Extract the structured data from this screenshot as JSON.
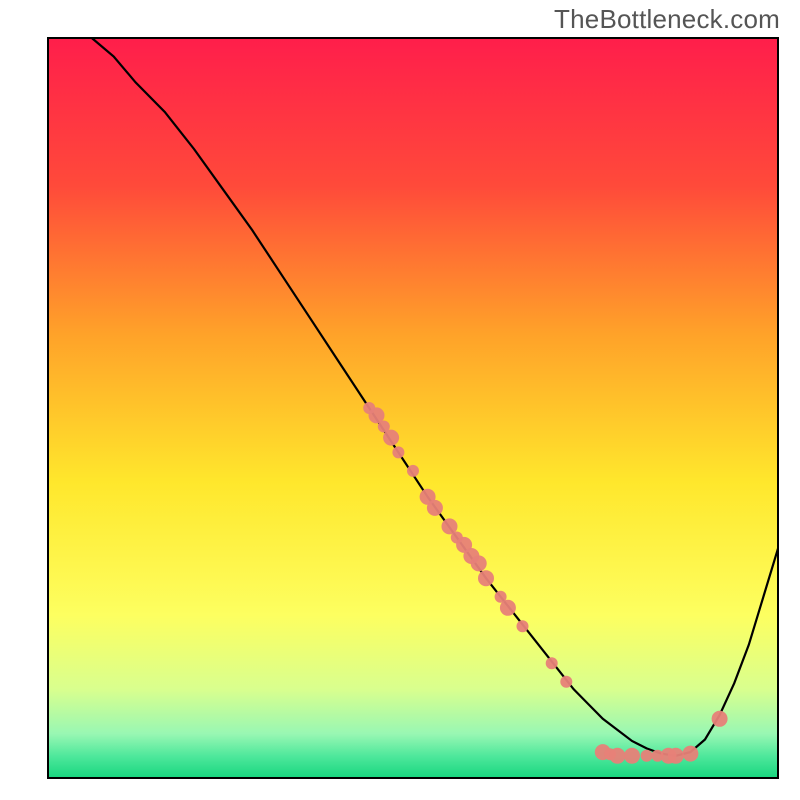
{
  "watermark": "TheBottleneck.com",
  "chart_data": {
    "type": "line",
    "title": "",
    "xlabel": "",
    "ylabel": "",
    "xlim": [
      0,
      100
    ],
    "ylim": [
      0,
      100
    ],
    "grid": false,
    "legend": false,
    "background_gradient": {
      "direction": "top-to-bottom",
      "stops": [
        {
          "pos": 0.0,
          "color": "#ff1e4b"
        },
        {
          "pos": 0.2,
          "color": "#ff4a3a"
        },
        {
          "pos": 0.4,
          "color": "#ffa229"
        },
        {
          "pos": 0.6,
          "color": "#ffe72c"
        },
        {
          "pos": 0.78,
          "color": "#fdff60"
        },
        {
          "pos": 0.88,
          "color": "#d9ff8e"
        },
        {
          "pos": 0.94,
          "color": "#99f7b3"
        },
        {
          "pos": 0.97,
          "color": "#4fe89c"
        },
        {
          "pos": 1.0,
          "color": "#18d67f"
        }
      ]
    },
    "series": [
      {
        "name": "bottleneck-curve",
        "color": "#000000",
        "x": [
          6,
          9,
          12,
          16,
          20,
          24,
          28,
          32,
          36,
          40,
          44,
          48,
          52,
          56,
          60,
          64,
          68,
          72,
          74,
          76,
          78,
          80,
          82,
          84,
          86,
          88,
          90,
          92,
          94,
          96,
          100
        ],
        "y": [
          100,
          97.5,
          94,
          90,
          85,
          79.5,
          74,
          68,
          62,
          56,
          50,
          44,
          38,
          32.5,
          27,
          22,
          17,
          12,
          10,
          8,
          6.5,
          5,
          4,
          3.3,
          3,
          3.5,
          5.2,
          8.5,
          12.8,
          18,
          31
        ]
      }
    ],
    "scatter_points": {
      "name": "data-points",
      "color": "#e78178",
      "radius_small": 6,
      "radius_large": 8,
      "points": [
        {
          "x": 44,
          "y": 50,
          "r": 6
        },
        {
          "x": 45,
          "y": 49,
          "r": 8
        },
        {
          "x": 46,
          "y": 47.5,
          "r": 6
        },
        {
          "x": 47,
          "y": 46,
          "r": 8
        },
        {
          "x": 48,
          "y": 44,
          "r": 6
        },
        {
          "x": 50,
          "y": 41.5,
          "r": 6
        },
        {
          "x": 52,
          "y": 38,
          "r": 8
        },
        {
          "x": 53,
          "y": 36.5,
          "r": 8
        },
        {
          "x": 55,
          "y": 34,
          "r": 8
        },
        {
          "x": 56,
          "y": 32.5,
          "r": 6
        },
        {
          "x": 57,
          "y": 31.5,
          "r": 8
        },
        {
          "x": 58,
          "y": 30,
          "r": 8
        },
        {
          "x": 59,
          "y": 29,
          "r": 8
        },
        {
          "x": 60,
          "y": 27,
          "r": 8
        },
        {
          "x": 62,
          "y": 24.5,
          "r": 6
        },
        {
          "x": 63,
          "y": 23,
          "r": 8
        },
        {
          "x": 65,
          "y": 20.5,
          "r": 6
        },
        {
          "x": 69,
          "y": 15.5,
          "r": 6
        },
        {
          "x": 71,
          "y": 13,
          "r": 6
        },
        {
          "x": 76,
          "y": 3.5,
          "r": 8
        },
        {
          "x": 77,
          "y": 3.2,
          "r": 6
        },
        {
          "x": 78,
          "y": 3,
          "r": 8
        },
        {
          "x": 80,
          "y": 3,
          "r": 8
        },
        {
          "x": 82,
          "y": 3,
          "r": 6
        },
        {
          "x": 83.5,
          "y": 3,
          "r": 6
        },
        {
          "x": 85,
          "y": 3,
          "r": 8
        },
        {
          "x": 86,
          "y": 3,
          "r": 8
        },
        {
          "x": 88,
          "y": 3.3,
          "r": 8
        },
        {
          "x": 92,
          "y": 8,
          "r": 8
        }
      ]
    }
  }
}
